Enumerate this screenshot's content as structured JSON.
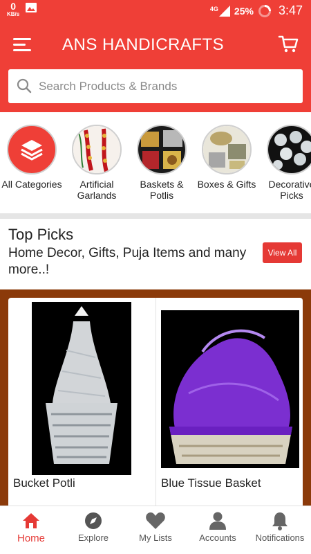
{
  "status_bar": {
    "speed_value": "0",
    "speed_unit": "KB/s",
    "network": "4G",
    "battery": "25%",
    "time": "3:47"
  },
  "app_bar": {
    "title": "ANS HANDICRAFTS"
  },
  "search": {
    "placeholder": "Search Products & Brands"
  },
  "categories": [
    {
      "label": "All Categories"
    },
    {
      "label": "Artificial Garlands"
    },
    {
      "label": "Baskets & Potlis"
    },
    {
      "label": "Boxes & Gifts"
    },
    {
      "label": "Decorative Picks"
    }
  ],
  "top_picks": {
    "title": "Top Picks",
    "subtitle": "Home Decor, Gifts, Puja Items and many more..!",
    "view_all_label": "View All"
  },
  "products": [
    {
      "name": "Bucket Potli"
    },
    {
      "name": "Blue Tissue Basket"
    }
  ],
  "bottom_nav": [
    {
      "label": "Home",
      "active": true
    },
    {
      "label": "Explore"
    },
    {
      "label": "My Lists"
    },
    {
      "label": "Accounts"
    },
    {
      "label": "Notifications"
    }
  ],
  "colors": {
    "brand_red": "#ef3f37",
    "products_background": "#8b3a0a"
  }
}
